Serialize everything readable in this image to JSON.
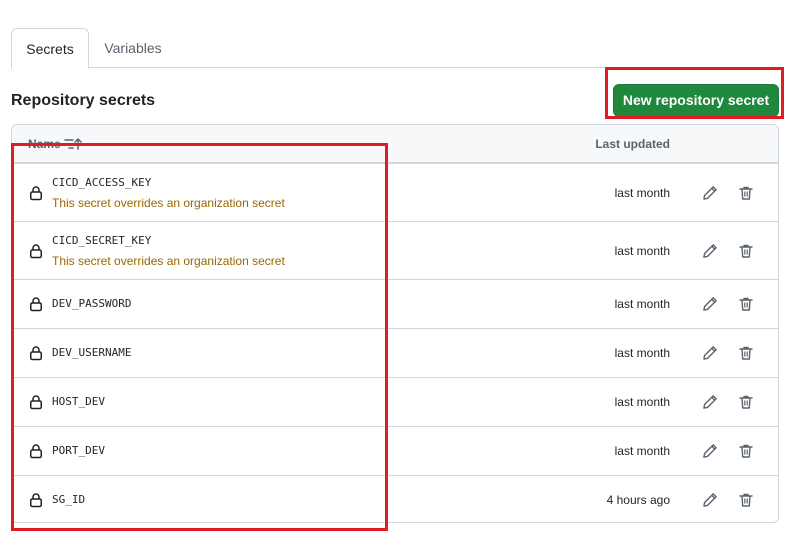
{
  "tabs": [
    {
      "label": "Secrets",
      "selected": true
    },
    {
      "label": "Variables",
      "selected": false
    }
  ],
  "section_title": "Repository secrets",
  "new_button_label": "New repository secret",
  "table": {
    "col_name": "Name",
    "col_updated": "Last updated",
    "rows": [
      {
        "name": "CICD_ACCESS_KEY",
        "note": "This secret overrides an organization secret",
        "updated": "last month"
      },
      {
        "name": "CICD_SECRET_KEY",
        "note": "This secret overrides an organization secret",
        "updated": "last month"
      },
      {
        "name": "DEV_PASSWORD",
        "note": "",
        "updated": "last month"
      },
      {
        "name": "DEV_USERNAME",
        "note": "",
        "updated": "last month"
      },
      {
        "name": "HOST_DEV",
        "note": "",
        "updated": "last month"
      },
      {
        "name": "PORT_DEV",
        "note": "",
        "updated": "last month"
      },
      {
        "name": "SG_ID",
        "note": "",
        "updated": "4 hours ago"
      }
    ]
  },
  "icons": {
    "row_lead": "lock-icon",
    "edit": "pencil-icon",
    "delete": "trash-icon",
    "sort": "sort-descending-icon"
  },
  "colors": {
    "primary_button": "#1f883d",
    "note_text": "#9a6700",
    "highlight": "#e01b24",
    "border": "#d0d7de"
  }
}
